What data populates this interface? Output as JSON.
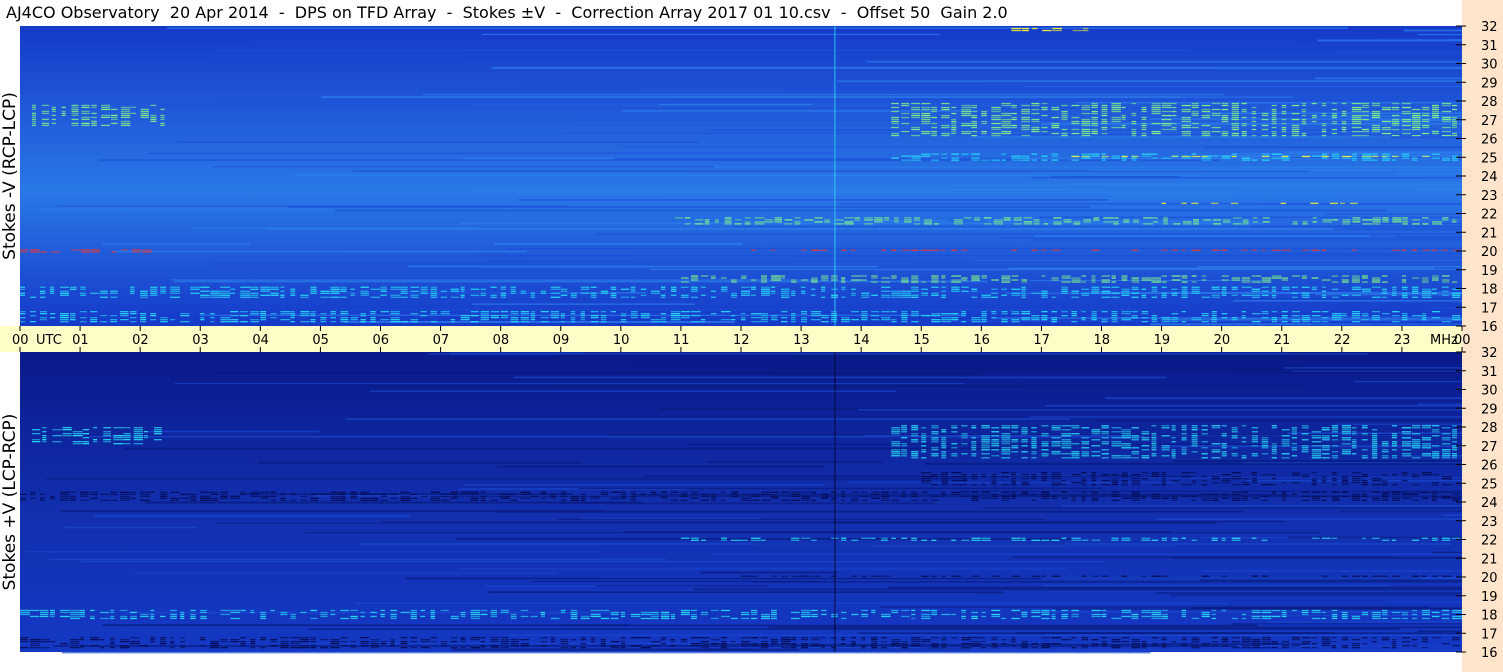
{
  "title": "AJ4CO Observatory  20 Apr 2014  -  DPS on TFD Array  -  Stokes ±V  -  Correction Array 2017 01 10.csv  -  Offset 50  Gain 2.0",
  "colors": {
    "background_low": "#0a1a8a",
    "background_mid": "#1539c8",
    "background_high": "#2a78e8",
    "cyan": "#27d6f5",
    "green": "#7ef08a",
    "yellow": "#f2f03a",
    "red": "#e63a3a",
    "time_bar": "#fffdc7",
    "freq_strip": "#ffe4cc"
  },
  "chart_data": [
    {
      "type": "heatmap",
      "panel": "top",
      "ylabel": "Stokes -V  (RCP-LCP)",
      "y_unit": "MHz",
      "ylim": [
        16,
        32
      ],
      "y_ticks": [
        "16",
        "17",
        "18",
        "19",
        "20",
        "21",
        "22",
        "23",
        "24",
        "25",
        "26",
        "27",
        "28",
        "29",
        "30",
        "31",
        "32"
      ],
      "x_unit": "UTC",
      "x_ticks": [
        "00",
        "01",
        "02",
        "03",
        "04",
        "05",
        "06",
        "07",
        "08",
        "09",
        "10",
        "11",
        "12",
        "13",
        "14",
        "15",
        "16",
        "17",
        "18",
        "19",
        "20",
        "21",
        "22",
        "23",
        "00"
      ],
      "xlim_hours": [
        0,
        24
      ],
      "bands": [
        {
          "t0": 0.2,
          "t1": 2.5,
          "f": 27.2,
          "w": 1.2,
          "level": "green"
        },
        {
          "t0": 14.5,
          "t1": 24,
          "f": 27.0,
          "w": 1.8,
          "level": "green"
        },
        {
          "t0": 14.5,
          "t1": 24,
          "f": 25.0,
          "w": 0.4,
          "level": "cyan"
        },
        {
          "t0": 17.0,
          "t1": 24,
          "f": 25.0,
          "w": 0.15,
          "level": "yellow"
        },
        {
          "t0": 10.9,
          "t1": 24,
          "f": 21.6,
          "w": 0.4,
          "level": "green"
        },
        {
          "t0": 19.0,
          "t1": 22.3,
          "f": 22.5,
          "w": 0.15,
          "level": "yellow"
        },
        {
          "t0": 0.0,
          "t1": 2.2,
          "f": 20.0,
          "w": 0.18,
          "level": "red"
        },
        {
          "t0": 12.0,
          "t1": 24,
          "f": 20.0,
          "w": 0.15,
          "level": "red"
        },
        {
          "t0": 0.0,
          "t1": 24,
          "f": 17.8,
          "w": 0.6,
          "level": "cyan"
        },
        {
          "t0": 11.0,
          "t1": 24,
          "f": 18.5,
          "w": 0.4,
          "level": "green"
        },
        {
          "t0": 16.5,
          "t1": 18.2,
          "f": 31.8,
          "w": 0.2,
          "level": "yellow"
        },
        {
          "t0": 0.0,
          "t1": 24,
          "f": 16.5,
          "w": 0.6,
          "level": "cyan"
        }
      ]
    },
    {
      "type": "heatmap",
      "panel": "bottom",
      "ylabel": "Stokes +V  (LCP-RCP)",
      "y_unit": "MHz",
      "ylim": [
        16,
        32
      ],
      "y_ticks": [
        "16",
        "17",
        "18",
        "19",
        "20",
        "21",
        "22",
        "23",
        "24",
        "25",
        "26",
        "27",
        "28",
        "29",
        "30",
        "31",
        "32"
      ],
      "x_unit": "UTC",
      "x_ticks": [
        "00",
        "01",
        "02",
        "03",
        "04",
        "05",
        "06",
        "07",
        "08",
        "09",
        "10",
        "11",
        "12",
        "13",
        "14",
        "15",
        "16",
        "17",
        "18",
        "19",
        "20",
        "21",
        "22",
        "23",
        "00"
      ],
      "xlim_hours": [
        0,
        24
      ],
      "bands": [
        {
          "t0": 0.2,
          "t1": 2.4,
          "f": 27.5,
          "w": 1.0,
          "level": "cyan"
        },
        {
          "t0": 14.5,
          "t1": 24,
          "f": 27.2,
          "w": 1.8,
          "level": "cyan"
        },
        {
          "t0": 15.0,
          "t1": 24,
          "f": 25.2,
          "w": 0.8,
          "level": "dark"
        },
        {
          "t0": 0.0,
          "t1": 24,
          "f": 24.3,
          "w": 0.5,
          "level": "dark"
        },
        {
          "t0": 12.0,
          "t1": 24,
          "f": 20.0,
          "w": 0.15,
          "level": "dark"
        },
        {
          "t0": 0.0,
          "t1": 24,
          "f": 18.0,
          "w": 0.5,
          "level": "cyan"
        },
        {
          "t0": 0.0,
          "t1": 24,
          "f": 16.5,
          "w": 0.6,
          "level": "dark"
        },
        {
          "t0": 11.0,
          "t1": 24,
          "f": 22.0,
          "w": 0.2,
          "level": "cyan"
        }
      ]
    }
  ]
}
